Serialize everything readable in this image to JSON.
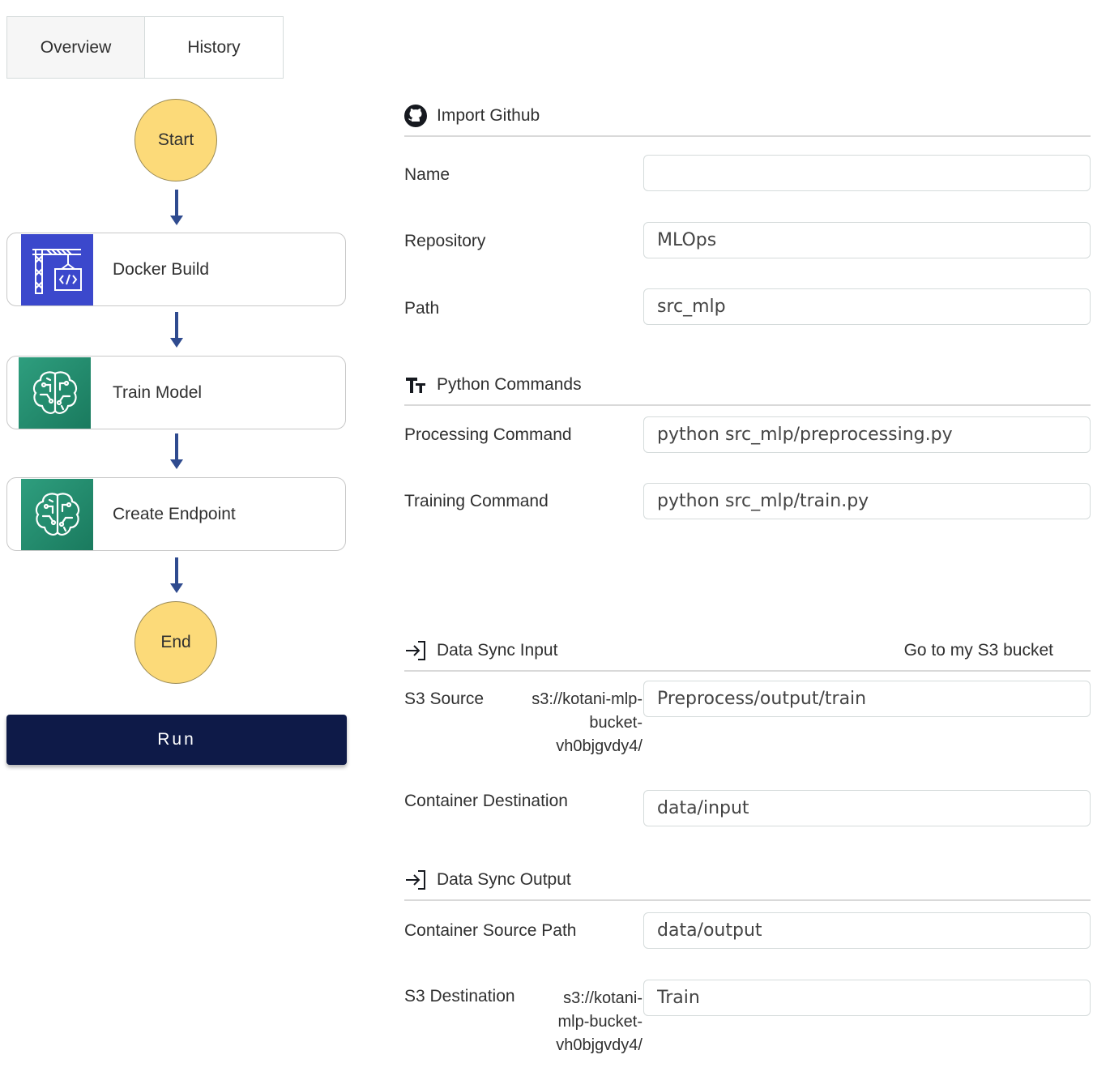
{
  "tabs": {
    "overview": "Overview",
    "history": "History"
  },
  "flow": {
    "start": "Start",
    "end": "End",
    "nodes": [
      {
        "label": "Docker Build",
        "icon": "crane-icon"
      },
      {
        "label": "Train Model",
        "icon": "brain-icon"
      },
      {
        "label": "Create Endpoint",
        "icon": "brain-icon"
      }
    ],
    "run": "Run",
    "colors": {
      "circle": "#fcda79",
      "docker": "#3b48cc",
      "sagemaker": "#1a7a5e",
      "run": "#0e1a48",
      "arrow": "#2f4b8f"
    }
  },
  "github": {
    "title": "Import Github",
    "name_label": "Name",
    "name_value": "",
    "repo_label": "Repository",
    "repo_value": "MLOps",
    "path_label": "Path",
    "path_value": "src_mlp"
  },
  "python": {
    "title": "Python Commands",
    "proc_label": "Processing Command",
    "proc_value": "python src_mlp/preprocessing.py",
    "train_label": "Training Command",
    "train_value": "python src_mlp/train.py"
  },
  "sync_input": {
    "title": "Data Sync Input",
    "link": "Go to my S3 bucket",
    "s3_label": "S3 Source",
    "s3_prefix": [
      "s3://kotani-mlp-",
      "bucket-",
      "vh0bjgvdy4/"
    ],
    "s3_value": "Preprocess/output/train",
    "dest_label": "Container Destination",
    "dest_value": "data/input"
  },
  "sync_output": {
    "title": "Data Sync Output",
    "src_label": "Container Source Path",
    "src_value": "data/output",
    "s3_label": "S3 Destination",
    "s3_prefix": [
      "s3://kotani-",
      "mlp-bucket-",
      "vh0bjgvdy4/"
    ],
    "s3_value": "Train"
  }
}
